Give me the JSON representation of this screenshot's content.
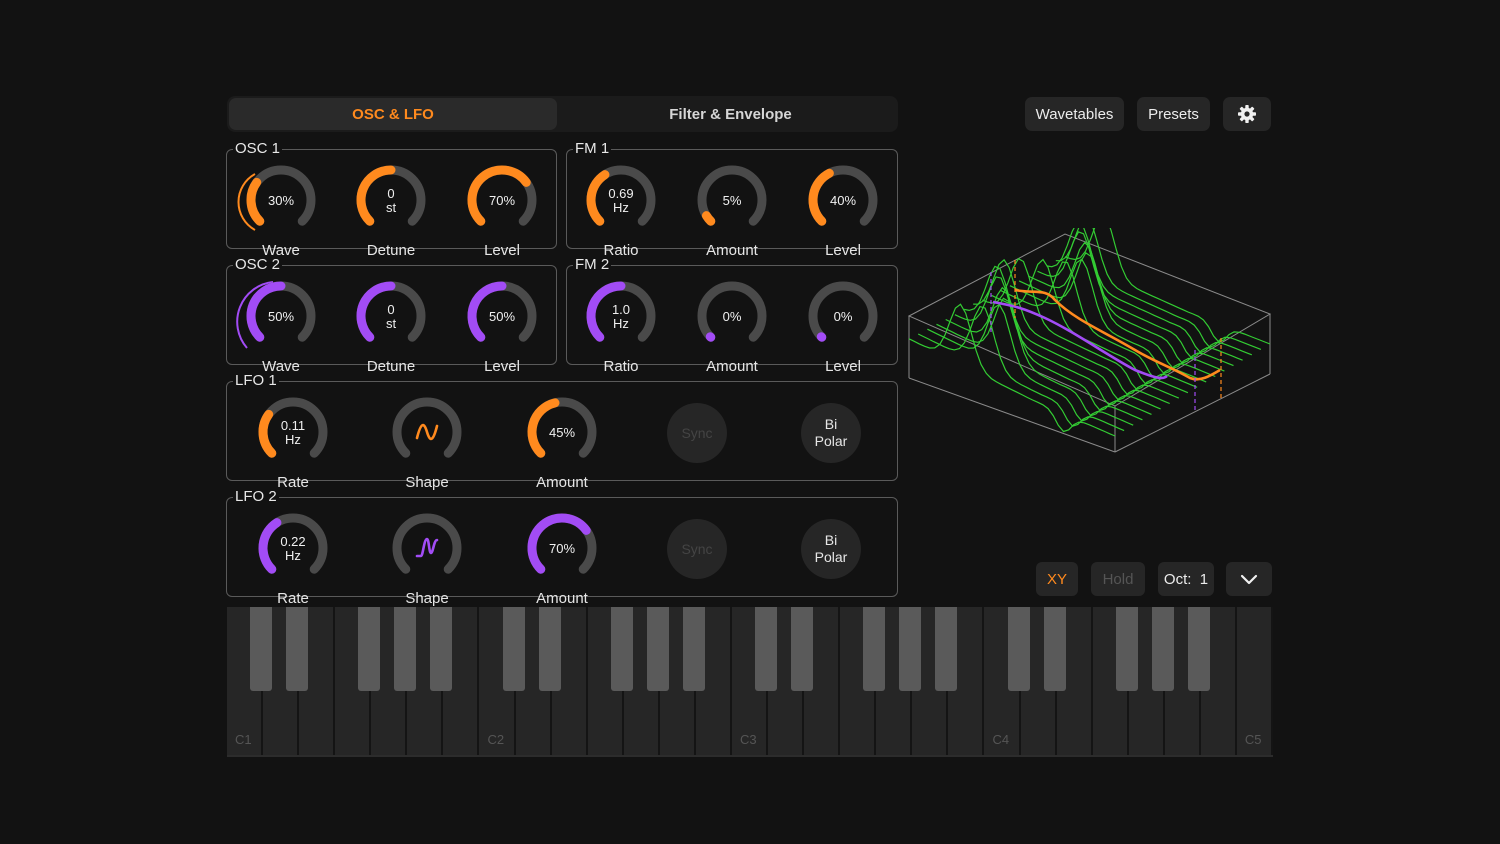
{
  "tabs": [
    {
      "label": "OSC & LFO",
      "active": true
    },
    {
      "label": "Filter & Envelope",
      "active": false
    }
  ],
  "toolbar": {
    "wavetables": "Wavetables",
    "presets": "Presets",
    "settings_icon": "gear-icon"
  },
  "colors": {
    "orange": "#ff8a1e",
    "purple": "#a24cf5",
    "green": "#33cc33",
    "track": "#4a4a4a"
  },
  "panels": {
    "osc1": {
      "title": "OSC 1",
      "knobs": [
        {
          "value": "30%",
          "label": "Wave",
          "level": 0.3
        },
        {
          "value_top": "0",
          "value_bottom": "st",
          "label": "Detune",
          "level": 0.5
        },
        {
          "value": "70%",
          "label": "Level",
          "level": 0.7
        }
      ]
    },
    "fm1": {
      "title": "FM 1",
      "knobs": [
        {
          "value_top": "0.69",
          "value_bottom": "Hz",
          "label": "Ratio",
          "level": 0.38
        },
        {
          "value": "5%",
          "label": "Amount",
          "level": 0.05
        },
        {
          "value": "40%",
          "label": "Level",
          "level": 0.4
        }
      ]
    },
    "osc2": {
      "title": "OSC 2",
      "knobs": [
        {
          "value": "50%",
          "label": "Wave",
          "level": 0.5
        },
        {
          "value_top": "0",
          "value_bottom": "st",
          "label": "Detune",
          "level": 0.5
        },
        {
          "value": "50%",
          "label": "Level",
          "level": 0.5
        }
      ]
    },
    "fm2": {
      "title": "FM 2",
      "knobs": [
        {
          "value_top": "1.0",
          "value_bottom": "Hz",
          "label": "Ratio",
          "level": 0.5
        },
        {
          "value": "0%",
          "label": "Amount",
          "level": 0.0
        },
        {
          "value": "0%",
          "label": "Level",
          "level": 0.0
        }
      ]
    },
    "lfo1": {
      "title": "LFO 1",
      "rate_top": "0.11",
      "rate_bottom": "Hz",
      "rate_label": "Rate",
      "rate_level": 0.3,
      "shape_label": "Shape",
      "amount": "45%",
      "amount_label": "Amount",
      "amount_level": 0.45,
      "sync": "Sync",
      "bipolar_top": "Bi",
      "bipolar_bottom": "Polar"
    },
    "lfo2": {
      "title": "LFO 2",
      "rate_top": "0.22",
      "rate_bottom": "Hz",
      "rate_label": "Rate",
      "rate_level": 0.38,
      "shape_label": "Shape",
      "amount": "70%",
      "amount_label": "Amount",
      "amount_level": 0.7,
      "sync": "Sync",
      "bipolar_top": "Bi",
      "bipolar_bottom": "Polar"
    }
  },
  "controls": {
    "xy": "XY",
    "hold": "Hold",
    "octave": "Oct:  1",
    "chevron_icon": "chevron-down-icon"
  },
  "keyboard": {
    "labels": [
      "C1",
      "C2",
      "C3",
      "C4",
      "C5"
    ]
  }
}
